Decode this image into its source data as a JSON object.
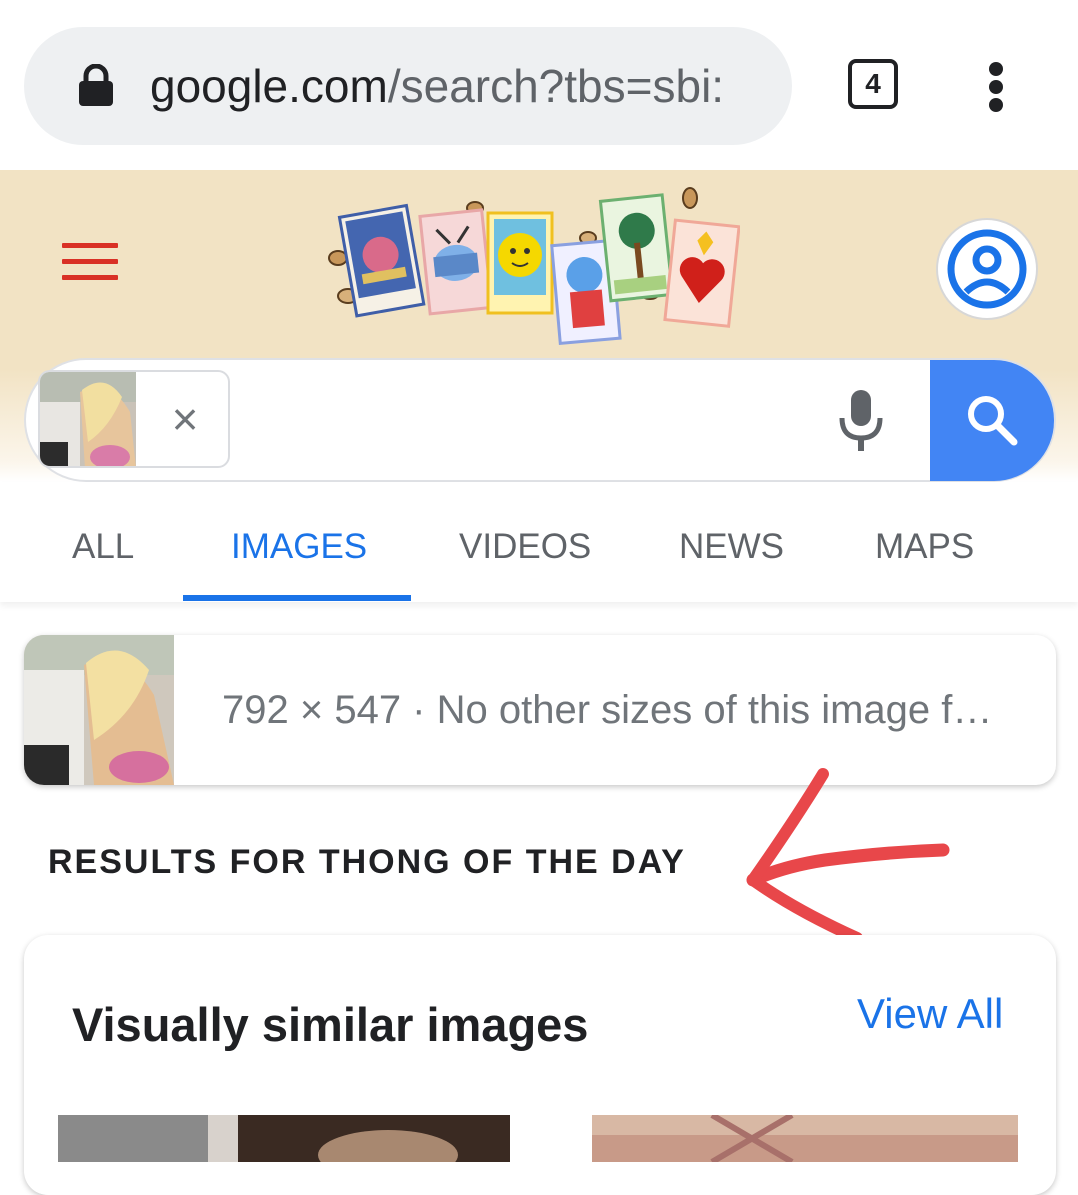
{
  "browser": {
    "url_primary": "google.com",
    "url_rest": "/search?tbs=sbi:",
    "tab_count": "4"
  },
  "header": {
    "doodle_icon": "loteria-doodle",
    "menu_icon": "hamburger-menu-icon",
    "account_icon": "account-circle-icon"
  },
  "search": {
    "clear_symbol": "×",
    "mic_icon": "microphone-icon",
    "search_icon": "magnifier-icon"
  },
  "tabs": [
    {
      "label": "ALL"
    },
    {
      "label": "IMAGES",
      "active": true
    },
    {
      "label": "VIDEOS"
    },
    {
      "label": "NEWS"
    },
    {
      "label": "MAPS"
    }
  ],
  "image_info": {
    "text": "792 × 547 · No other sizes of this image f…"
  },
  "results": {
    "heading": "RESULTS FOR THONG OF THE DAY"
  },
  "similar": {
    "title": "Visually similar images",
    "view_all": "View All"
  },
  "colors": {
    "accent": "#1a73e8",
    "search_button": "#4285f4",
    "doodle_bg": "#f2e3c4",
    "annotation_arrow": "#e8474a",
    "menu_red": "#d93025"
  }
}
